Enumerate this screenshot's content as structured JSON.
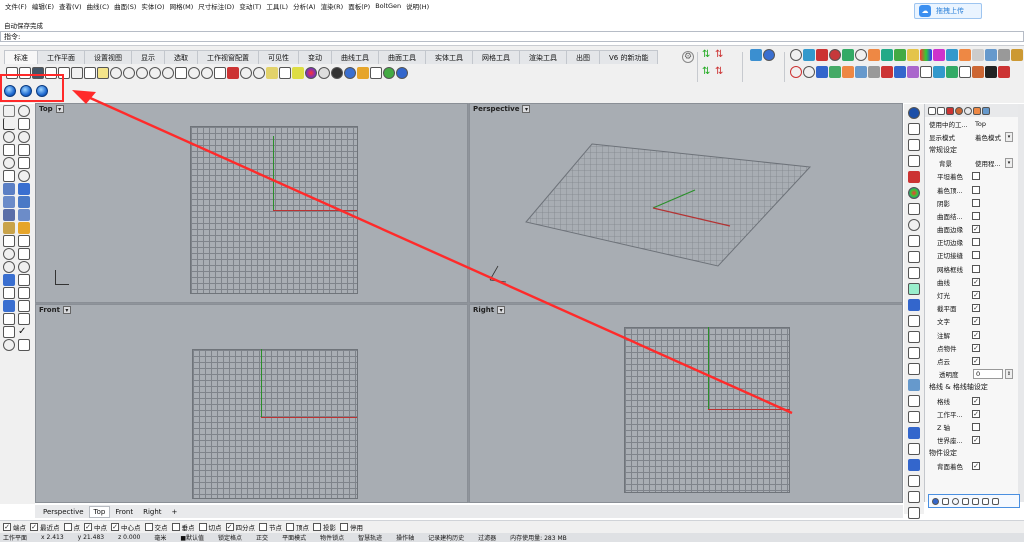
{
  "menu": [
    "文件(F)",
    "编辑(E)",
    "查看(V)",
    "曲线(C)",
    "曲面(S)",
    "实体(O)",
    "网格(M)",
    "尺寸标注(D)",
    "变动(T)",
    "工具(L)",
    "分析(A)",
    "渲染(R)",
    "面板(P)",
    "BoltGen",
    "说明(H)"
  ],
  "cmd": {
    "line1": "自动保存完成",
    "prompt": "指令:"
  },
  "upload_label": "拖拽上传",
  "tabs": [
    "标准",
    "工作平面",
    "设置视图",
    "显示",
    "选取",
    "工作视窗配置",
    "可见性",
    "变动",
    "曲线工具",
    "曲面工具",
    "实体工具",
    "网格工具",
    "渲染工具",
    "出图",
    "V6 的新功能"
  ],
  "viewports": {
    "top": "Top",
    "perspective": "Perspective",
    "front": "Front",
    "right": "Right"
  },
  "vp_tabs": [
    "Perspective",
    "Top",
    "Front",
    "Right"
  ],
  "panel": {
    "using_label": "使用中的工...",
    "using_value": "Top",
    "display_label": "显示模式",
    "display_value": "着色模式",
    "sec_general": "常规设定",
    "bg_label": "背景",
    "bg_value": "使用程...",
    "checks": [
      {
        "label": "平坦着色",
        "checked": false
      },
      {
        "label": "着色顶...",
        "checked": false
      },
      {
        "label": "阴影",
        "checked": false
      },
      {
        "label": "曲面结...",
        "checked": false
      },
      {
        "label": "曲面边缘",
        "checked": true
      },
      {
        "label": "正切边缘",
        "checked": false
      },
      {
        "label": "正切接缝",
        "checked": false
      },
      {
        "label": "网格框线",
        "checked": false
      },
      {
        "label": "曲线",
        "checked": true
      },
      {
        "label": "灯光",
        "checked": true
      },
      {
        "label": "截平面",
        "checked": true
      },
      {
        "label": "文字",
        "checked": true
      },
      {
        "label": "注解",
        "checked": true
      },
      {
        "label": "点物件",
        "checked": true
      },
      {
        "label": "点云",
        "checked": true
      }
    ],
    "transparency_label": "透明度",
    "transparency_value": "0",
    "sec_grid": "格线 & 格线轴设定",
    "grid_checks": [
      {
        "label": "格线",
        "checked": true
      },
      {
        "label": "工作平...",
        "checked": true
      },
      {
        "label": "Z 轴",
        "checked": false
      },
      {
        "label": "世界座...",
        "checked": true
      }
    ],
    "sec_object": "物件设定",
    "obj_checks": [
      {
        "label": "背面着色",
        "checked": true
      }
    ]
  },
  "osnap": [
    {
      "label": "端点",
      "checked": true
    },
    {
      "label": "最近点",
      "checked": true
    },
    {
      "label": "点",
      "checked": false
    },
    {
      "label": "中点",
      "checked": true
    },
    {
      "label": "中心点",
      "checked": true
    },
    {
      "label": "交点",
      "checked": false
    },
    {
      "label": "垂点",
      "checked": false
    },
    {
      "label": "切点",
      "checked": false
    },
    {
      "label": "四分点",
      "checked": true
    },
    {
      "label": "节点",
      "checked": false
    },
    {
      "label": "顶点",
      "checked": false
    },
    {
      "label": "投影",
      "checked": false
    },
    {
      "label": "停用",
      "checked": false
    }
  ],
  "status": [
    "工作平面",
    "x 2.413",
    "y 21.483",
    "z 0.000",
    "毫米",
    "■默认值",
    "锁定格点",
    "正交",
    "平面模式",
    "物件锁点",
    "智慧轨迹",
    "操作轴",
    "记录建构历史",
    "过滤器",
    "内存使用量: 283 MB"
  ],
  "colors": {
    "annotation": "#ff2a2a",
    "viewport_bg": "#a8adb3",
    "x_axis": "#b33333",
    "y_axis": "#2a8f2a"
  }
}
